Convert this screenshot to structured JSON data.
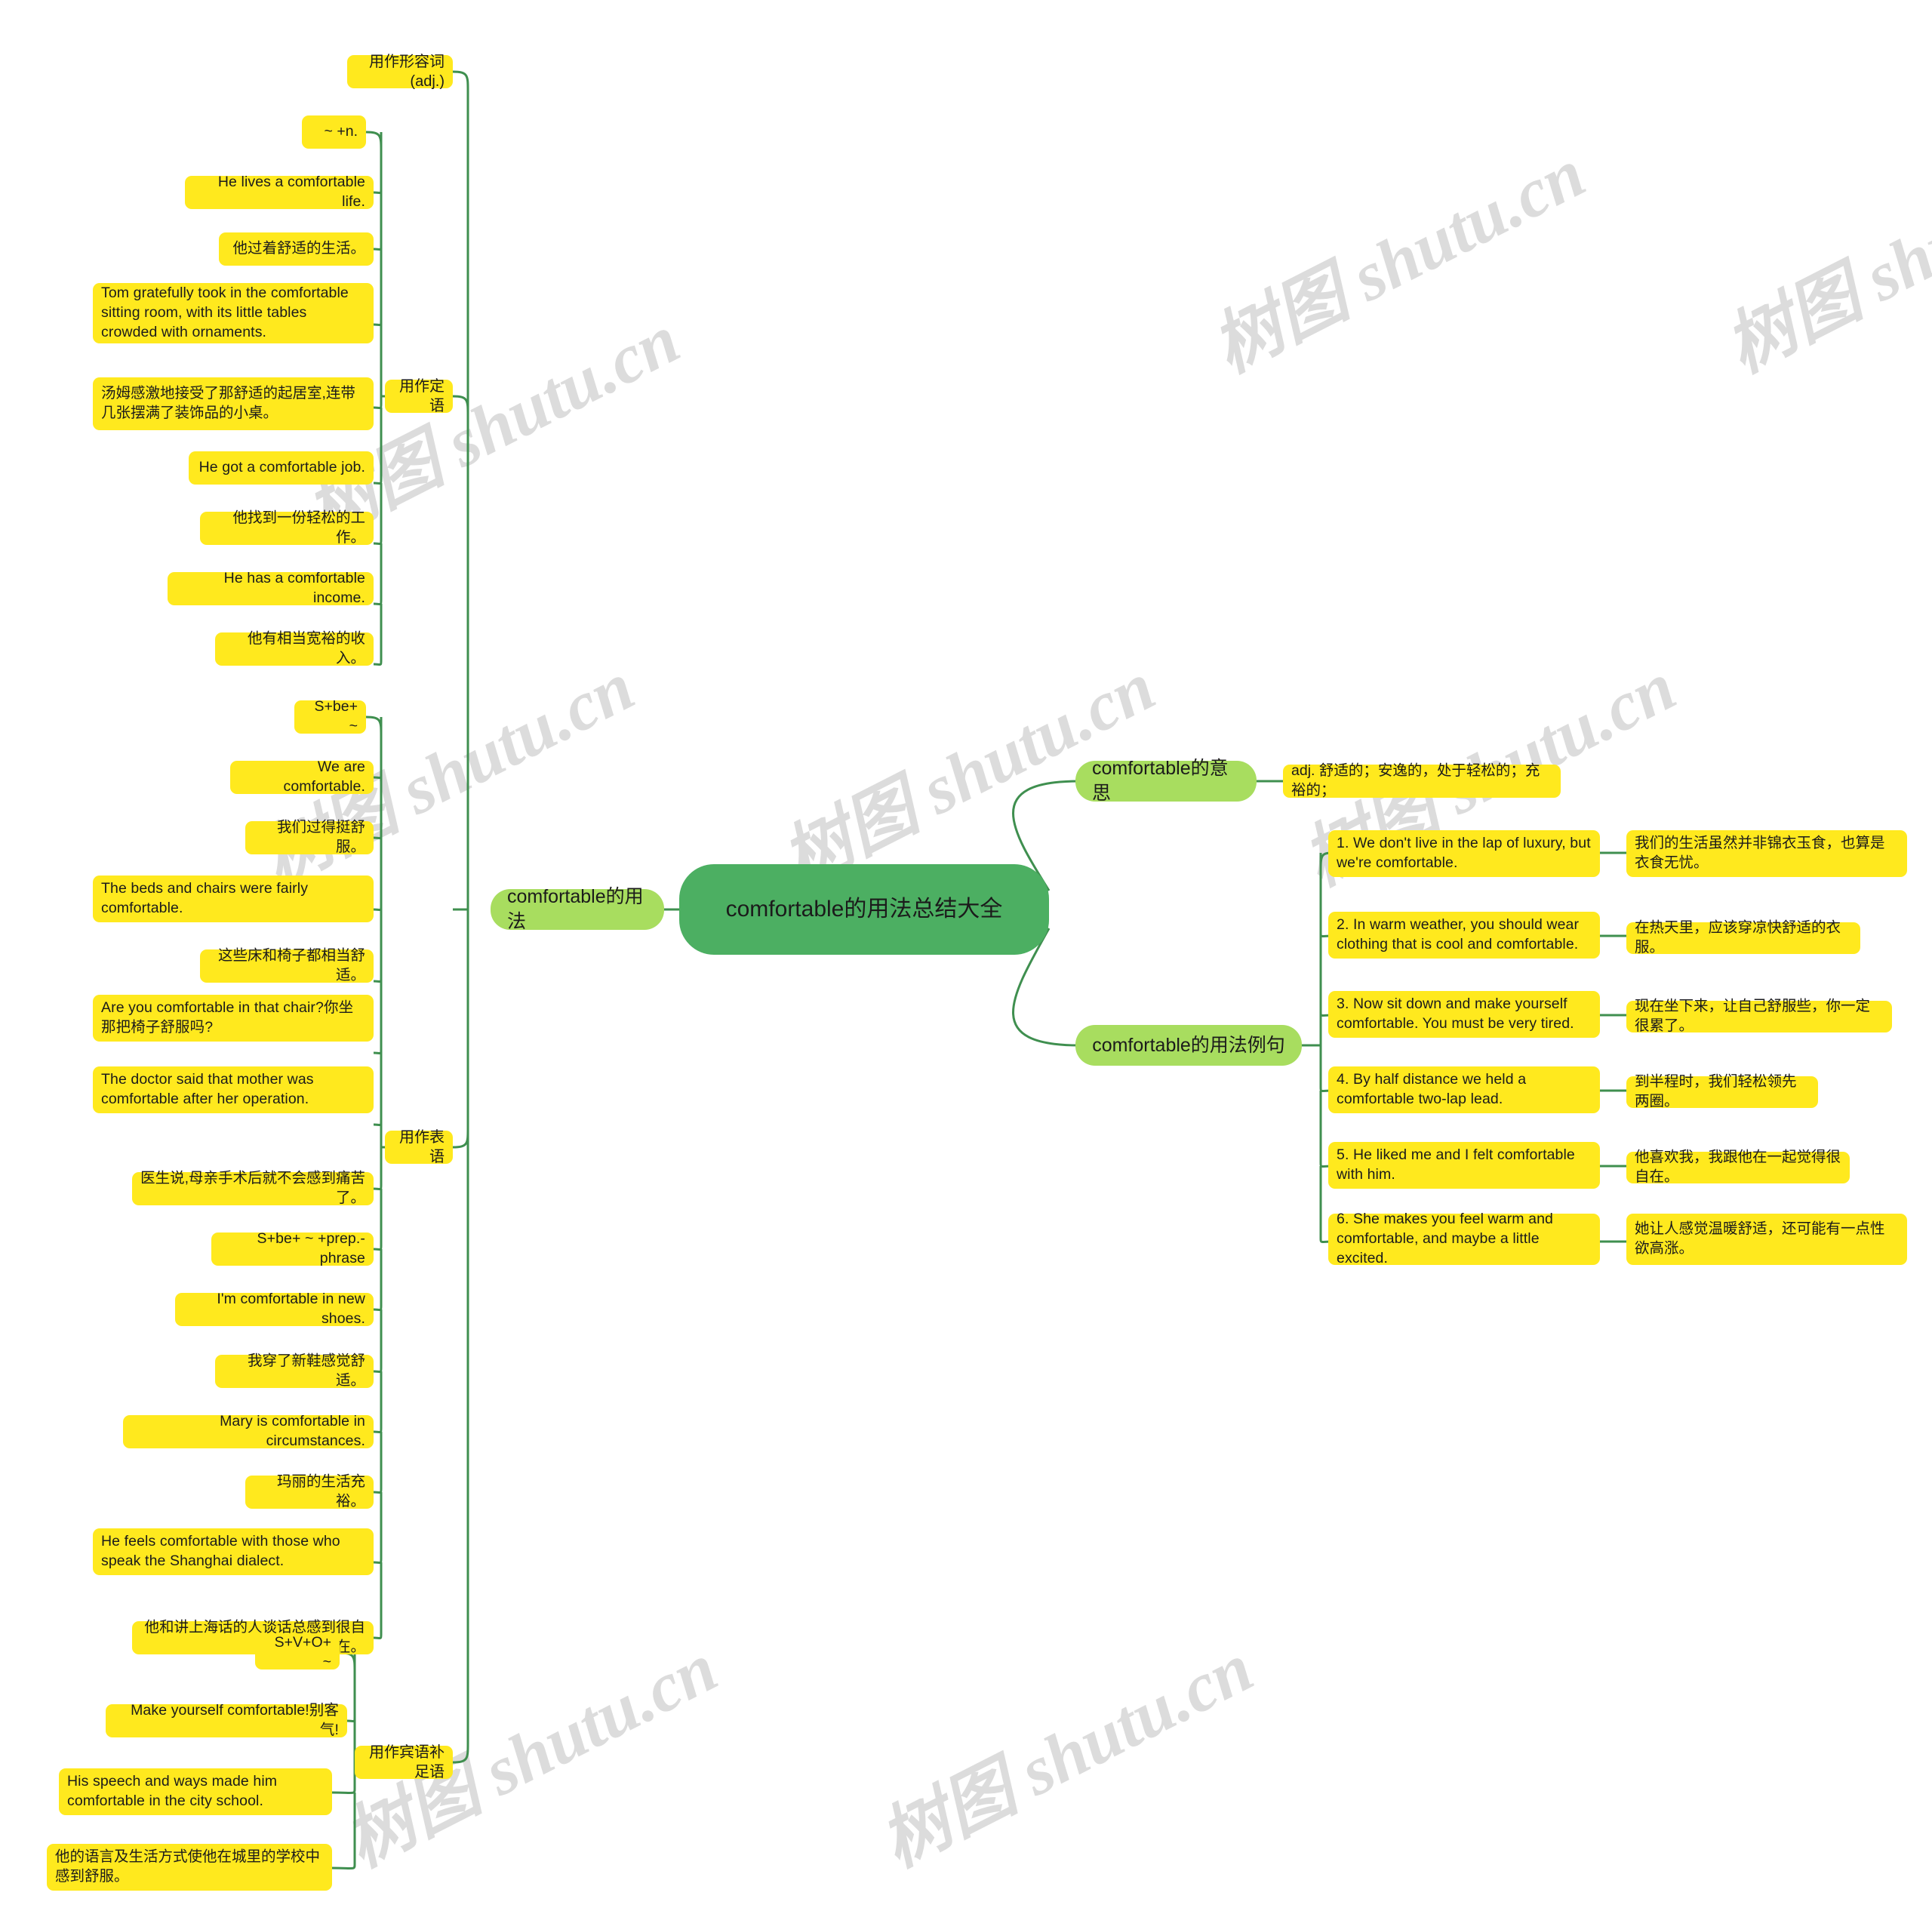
{
  "root": {
    "title": "comfortable的用法总结大全"
  },
  "watermark": {
    "text": "树图 shutu.cn"
  },
  "branches": {
    "usage": {
      "label": "comfortable的用法"
    },
    "meaning": {
      "label": "comfortable的意思"
    },
    "examples": {
      "label": "comfortable的用法例句"
    }
  },
  "meaning_value": "adj. 舒适的；安逸的，处于轻松的；充裕的；",
  "usage_groups": [
    {
      "label": "用作形容词(adj.)",
      "children": []
    },
    {
      "label": "用作定语",
      "children": [
        "~ +n.",
        "He lives a comfortable life.",
        "他过着舒适的生活。",
        "Tom gratefully took in the comfortable sitting room, with its little tables crowded with ornaments.",
        "汤姆感激地接受了那舒适的起居室,连带几张摆满了装饰品的小桌。",
        "He got a comfortable job.",
        "他找到一份轻松的工作。",
        "He has a comfortable income.",
        "他有相当宽裕的收入。"
      ]
    },
    {
      "label": "用作表语",
      "children": [
        "S+be+ ~",
        "We are comfortable.",
        "我们过得挺舒服。",
        "The beds and chairs were fairly comfortable.",
        "这些床和椅子都相当舒适。",
        "Are you comfortable in that chair?你坐那把椅子舒服吗?",
        "The doctor said that mother was comfortable after her operation.",
        "医生说,母亲手术后就不会感到痛苦了。",
        "S+be+ ~ +prep.-phrase",
        "I'm comfortable in new shoes.",
        "我穿了新鞋感觉舒适。",
        "Mary is comfortable in circumstances.",
        "玛丽的生活充裕。",
        "He feels comfortable with those who speak the Shanghai dialect.",
        "他和讲上海话的人谈话总感到很自在。"
      ]
    },
    {
      "label": "用作宾语补足语",
      "children": [
        "S+V+O+ ~",
        "Make yourself comfortable!别客气!",
        "His speech and ways made him comfortable in the city school.",
        "他的语言及生活方式使他在城里的学校中感到舒服。"
      ]
    }
  ],
  "example_sentences": [
    {
      "en": "1. We don't live in the lap of luxury, but we're comfortable.",
      "zh": "我们的生活虽然并非锦衣玉食，也算是衣食无忧。"
    },
    {
      "en": "2. In warm weather, you should wear clothing that is cool and comfortable.",
      "zh": "在热天里，应该穿凉快舒适的衣服。"
    },
    {
      "en": "3. Now sit down and make yourself comfortable. You must be very tired.",
      "zh": "现在坐下来，让自己舒服些，你一定很累了。"
    },
    {
      "en": "4. By half distance we held a comfortable two-lap lead.",
      "zh": "到半程时，我们轻松领先两圈。"
    },
    {
      "en": "5. He liked me and I felt comfortable with him.",
      "zh": "他喜欢我，我跟他在一起觉得很自在。"
    },
    {
      "en": "6. She makes you feel warm and comfortable, and maybe a little excited.",
      "zh": "她让人感觉温暖舒适，还可能有一点性欲高涨。"
    }
  ],
  "colors": {
    "root_fill": "#4caf62",
    "level2_fill": "#a8dd5f",
    "leaf_fill": "#ffe91e",
    "line": "#3f8f4f",
    "watermark": "#dcdcdc"
  }
}
